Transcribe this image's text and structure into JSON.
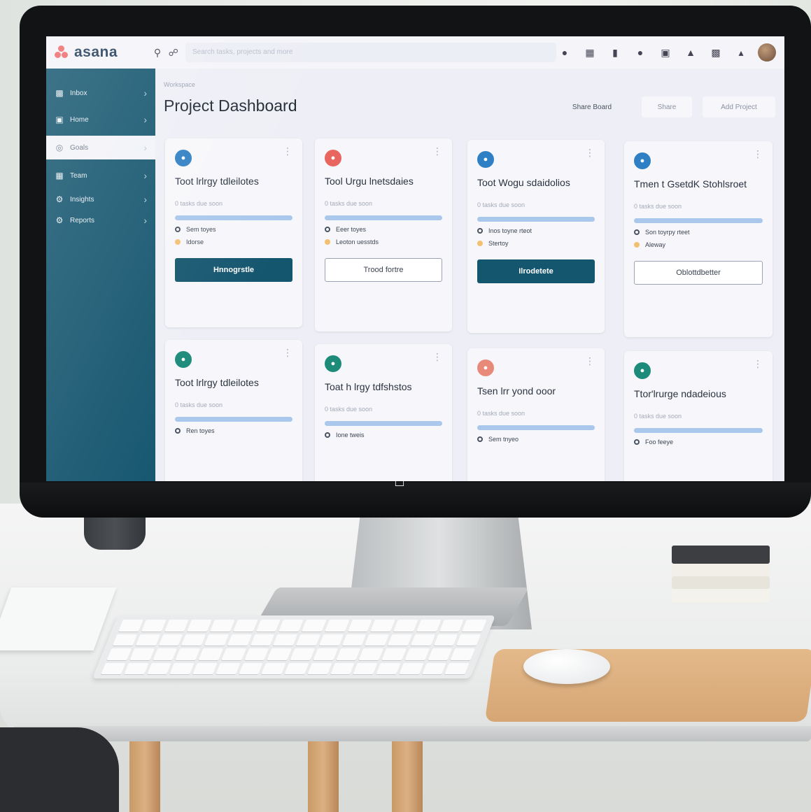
{
  "app": {
    "name": "asana"
  },
  "topbar": {
    "search_placeholder": "Search tasks, projects and more"
  },
  "sidebar": {
    "items": [
      {
        "label": "Inbox",
        "icon": "inbox-icon",
        "active": false
      },
      {
        "label": "Home",
        "icon": "home-icon",
        "active": false
      },
      {
        "label": "Goals",
        "icon": "goals-icon",
        "active": true
      },
      {
        "label": "Team",
        "icon": "team-icon",
        "active": false
      },
      {
        "label": "Insights",
        "icon": "insights-icon",
        "active": false
      },
      {
        "label": "Reports",
        "icon": "reports-icon",
        "active": false
      }
    ]
  },
  "main": {
    "breadcrumb": "Workspace",
    "title": "Project Dashboard",
    "actions": [
      {
        "label": "Share Board",
        "icon": "share-icon"
      },
      {
        "label": "Share",
        "icon": "share-icon"
      },
      {
        "label": "Add Project",
        "icon": "plus-icon"
      }
    ]
  },
  "cards": [
    {
      "icon_color": "#2f7fc4",
      "title": "Toot lrlrgy tdleilotes",
      "meta": "0 tasks due soon",
      "row1": "Sem toyes",
      "row2": "Idorse",
      "button": "Hnnogrstle",
      "button_style": "fill",
      "progress": 1.0
    },
    {
      "icon_color": "#e8665f",
      "title": "Tool Urgu lnetsdaies",
      "meta": "0 tasks due soon",
      "row1": "Eeer toyes",
      "row2": "Leoton uesstds",
      "button": "Trood fortre",
      "button_style": "line",
      "progress": 1.0
    },
    {
      "icon_color": "#2f7fc4",
      "title": "Toot Wogu sdaidolios",
      "meta": "0 tasks due soon",
      "row1": "Inos toyne rteot",
      "row2": "Stertoy",
      "button": "Ilrodetete",
      "button_style": "fill",
      "progress": 1.0
    },
    {
      "icon_color": "#2f7fc4",
      "title": "Tmen t GsetdK Stohlsroet",
      "meta": "0 tasks due soon",
      "row1": "Son toyrpy rteet",
      "row2": "Aleway",
      "button": "Oblottdbetter",
      "button_style": "line",
      "progress": 1.0
    },
    {
      "icon_color": "#1d8a7a",
      "title": "Toot lrlrgy tdleilotes",
      "meta": "0 tasks due soon",
      "row1": "Ren toyes",
      "row2": "",
      "button": "",
      "button_style": "none",
      "progress": 1.0
    },
    {
      "icon_color": "#1d8a7a",
      "title": "Toat h lrgy tdfshstos",
      "meta": "0 tasks due soon",
      "row1": "Ione tweis",
      "row2": "",
      "button": "",
      "button_style": "none",
      "progress": 1.0
    },
    {
      "icon_color": "#e88a7a",
      "title": "Tsen lrr yond ooor",
      "meta": "0 tasks due soon",
      "row1": "Sem tnyeo",
      "row2": "",
      "button": "",
      "button_style": "none",
      "progress": 1.0
    },
    {
      "icon_color": "#1d8a7a",
      "title": "Ttor'lrurge ndadeious",
      "meta": "0 tasks due soon",
      "row1": "Foo feeye",
      "row2": "",
      "button": "",
      "button_style": "none",
      "progress": 1.0
    }
  ]
}
